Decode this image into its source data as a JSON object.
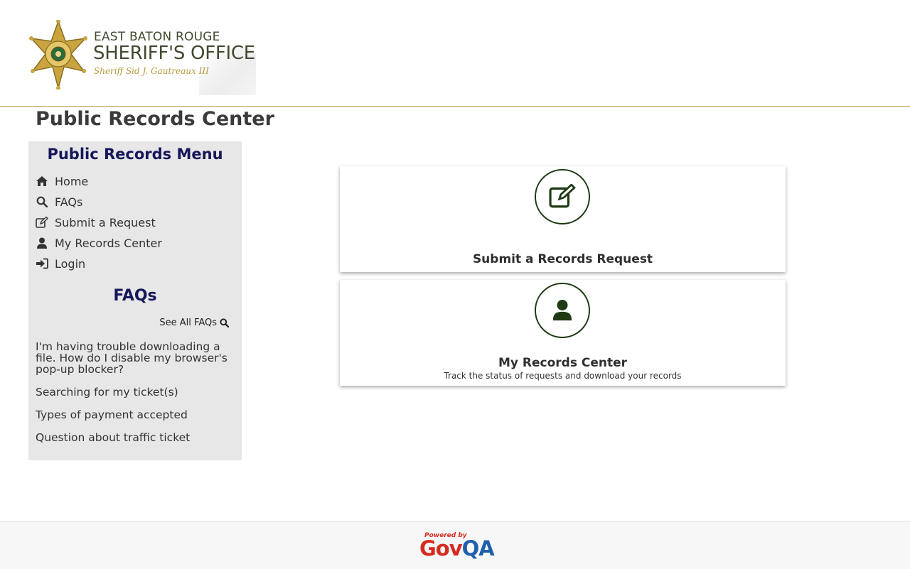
{
  "header": {
    "logo": {
      "line1": "EAST BATON ROUGE",
      "line2": "SHERIFF'S OFFICE",
      "line3": "Sheriff Sid J. Gautreaux III"
    }
  },
  "page_title": "Public Records Center",
  "sidebar": {
    "menu_title": "Public Records Menu",
    "items": [
      {
        "label": "Home",
        "icon": "home-icon"
      },
      {
        "label": "FAQs",
        "icon": "search-icon"
      },
      {
        "label": "Submit a Request",
        "icon": "edit-icon"
      },
      {
        "label": "My Records Center",
        "icon": "user-icon"
      },
      {
        "label": "Login",
        "icon": "sign-in-icon"
      }
    ],
    "faqs_title": "FAQs",
    "see_all_label": "See All FAQs",
    "faqs": [
      "I'm having trouble downloading a file. How do I disable my browser's pop-up blocker?",
      "Searching for my ticket(s)",
      "Types of payment accepted",
      "Question about traffic ticket"
    ]
  },
  "cards": [
    {
      "title": "Submit a Records Request",
      "icon": "edit-icon"
    },
    {
      "title": "My Records Center",
      "subtitle": "Track the status of requests and download your records",
      "icon": "user-icon"
    }
  ],
  "footer": {
    "powered_by": "Powered by",
    "brand_gov": "Gov",
    "brand_qa": "QA"
  },
  "colors": {
    "accent_navy": "#16175a",
    "header_rule": "#b39a4e",
    "icon_green": "#1f3a14",
    "govqa_red": "#d52b1e",
    "govqa_blue": "#1f5fae"
  }
}
